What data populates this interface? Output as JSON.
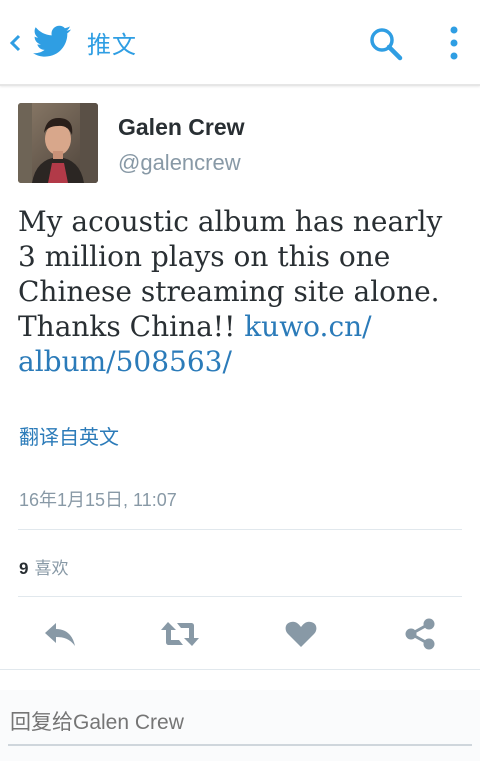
{
  "header": {
    "title": "推文",
    "back_icon": "chevron-left-icon",
    "logo_icon": "twitter-bird-icon",
    "search_icon": "search-icon",
    "more_icon": "more-vertical-icon",
    "accent_color": "#2f9ee3"
  },
  "tweet": {
    "author_name": "Galen Crew",
    "author_handle": "@galencrew",
    "text_lines": [
      "My acoustic album has nearly",
      "3 million plays on this one",
      "Chinese streaming site alone.",
      "Thanks China!! "
    ],
    "link_part1": "kuwo.cn/",
    "link_part2": "album/508563/",
    "translate_label": "翻译自英文",
    "timestamp": "16年1月15日, 11:07",
    "like_count": "9",
    "like_label": "喜欢",
    "link_color": "#2b7bb9"
  },
  "actions": {
    "reply_icon": "reply-icon",
    "retweet_icon": "retweet-icon",
    "like_icon": "heart-icon",
    "share_icon": "share-icon"
  },
  "reply": {
    "placeholder": "回复给Galen Crew"
  }
}
